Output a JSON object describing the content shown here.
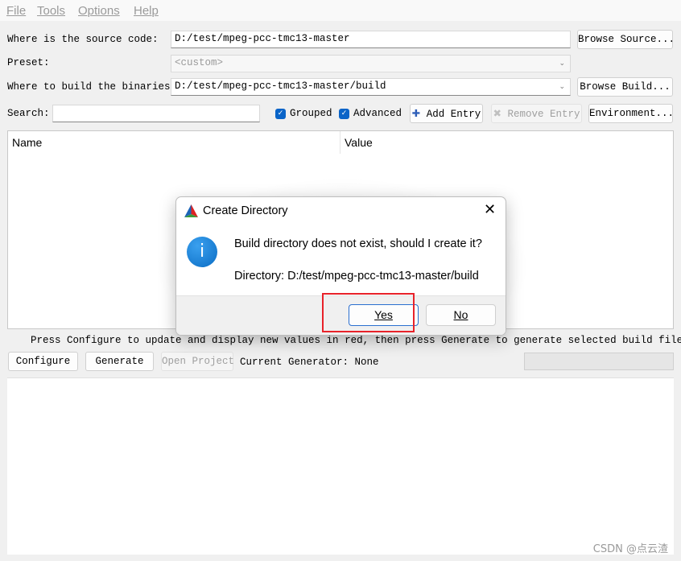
{
  "menu": [
    "File",
    "Tools",
    "Options",
    "Help"
  ],
  "source": {
    "label": "Where is the source code:",
    "value": "D:/test/mpeg-pcc-tmc13-master",
    "browse": "Browse Source..."
  },
  "preset": {
    "label": "Preset:",
    "value": "<custom>"
  },
  "build": {
    "label": "Where to build the binaries:",
    "value": "D:/test/mpeg-pcc-tmc13-master/build",
    "browse": "Browse Build..."
  },
  "search": {
    "label": "Search:",
    "value": ""
  },
  "toolbar": {
    "grouped": "Grouped",
    "advanced": "Advanced",
    "add": "Add Entry",
    "remove": "Remove Entry",
    "environment": "Environment..."
  },
  "table": {
    "columns": [
      "Name",
      "Value"
    ]
  },
  "hint": "Press Configure to update and display new values in red, then press Generate to generate selected build files.",
  "actions": {
    "configure": "Configure",
    "generate": "Generate",
    "open": "Open Project",
    "generator": "Current Generator: None"
  },
  "dialog": {
    "title": "Create Directory",
    "message": "Build directory does not exist, should I create it?",
    "directory": "Directory: D:/test/mpeg-pcc-tmc13-master/build",
    "yes": "Yes",
    "no": "No"
  },
  "watermark": "CSDN @点云渣",
  "colors": {
    "accent": "#0a64c8",
    "highlight": "#e8222a"
  }
}
